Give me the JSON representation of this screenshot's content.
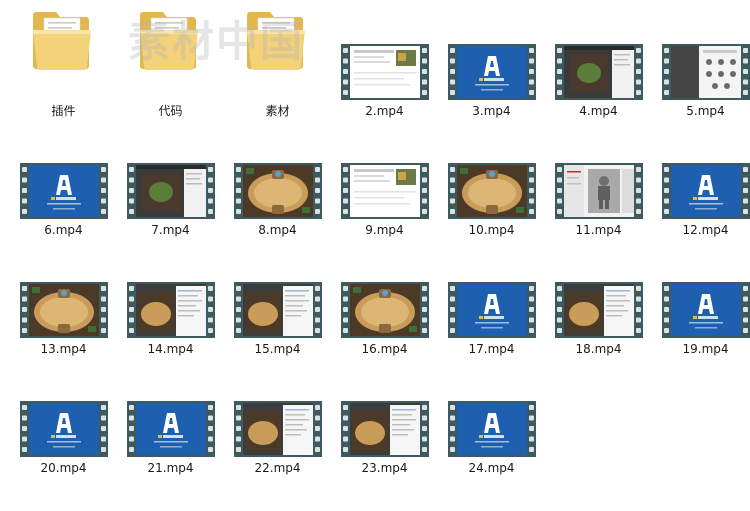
{
  "watermark_text": "素材中国",
  "folders": [
    {
      "name": "插件",
      "icon": "folder-icon"
    },
    {
      "name": "代码",
      "icon": "folder-icon"
    },
    {
      "name": "素材",
      "icon": "folder-icon"
    }
  ],
  "videos": [
    {
      "name": "2.mp4",
      "thumb": "web-page"
    },
    {
      "name": "3.mp4",
      "thumb": "blue-logo"
    },
    {
      "name": "4.mp4",
      "thumb": "dark-editor"
    },
    {
      "name": "5.mp4",
      "thumb": "panel-icons"
    },
    {
      "name": "6.mp4",
      "thumb": "blue-logo"
    },
    {
      "name": "7.mp4",
      "thumb": "dark-editor"
    },
    {
      "name": "8.mp4",
      "thumb": "game-board"
    },
    {
      "name": "9.mp4",
      "thumb": "web-page"
    },
    {
      "name": "10.mp4",
      "thumb": "game-board"
    },
    {
      "name": "11.mp4",
      "thumb": "character"
    },
    {
      "name": "12.mp4",
      "thumb": "blue-logo"
    },
    {
      "name": "13.mp4",
      "thumb": "game-board"
    },
    {
      "name": "14.mp4",
      "thumb": "game-editor"
    },
    {
      "name": "15.mp4",
      "thumb": "game-editor"
    },
    {
      "name": "16.mp4",
      "thumb": "game-board"
    },
    {
      "name": "17.mp4",
      "thumb": "blue-logo"
    },
    {
      "name": "18.mp4",
      "thumb": "game-editor"
    },
    {
      "name": "19.mp4",
      "thumb": "blue-logo"
    },
    {
      "name": "20.mp4",
      "thumb": "blue-logo"
    },
    {
      "name": "21.mp4",
      "thumb": "blue-logo"
    },
    {
      "name": "22.mp4",
      "thumb": "game-editor"
    },
    {
      "name": "23.mp4",
      "thumb": "game-editor"
    },
    {
      "name": "24.mp4",
      "thumb": "blue-logo"
    }
  ],
  "colors": {
    "film_frame": "#3f5a5e",
    "film_hole": "#d9e3e3",
    "logo_blue": "#1f5fb0",
    "folder_yellow": "#f3d27a"
  }
}
